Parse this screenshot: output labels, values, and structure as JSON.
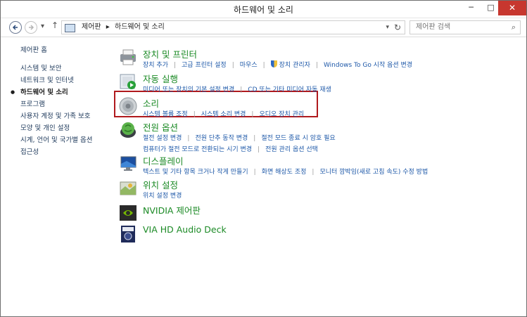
{
  "window": {
    "title": "하드웨어 및 소리"
  },
  "window_controls": {
    "minimize": "─",
    "maximize": "□",
    "close": "✕"
  },
  "nav": {
    "back_icon": "back-arrow-icon",
    "forward_icon": "forward-arrow-icon",
    "recent_glyph": "▾",
    "up_glyph": "↑",
    "breadcrumb": [
      "제어판",
      "▸",
      "하드웨어 및 소리"
    ],
    "dropdown_glyph": "▾",
    "refresh_glyph": "↻"
  },
  "search": {
    "placeholder": "제어판 검색",
    "icon_glyph": "⌕"
  },
  "sidebar": {
    "home": "제어판 홈",
    "items": [
      "시스템 및 보안",
      "네트워크 및 인터넷",
      "하드웨어 및 소리",
      "프로그램",
      "사용자 계정 및 가족 보호",
      "모양 및 개인 설정",
      "시계, 언어 및 국가별 옵션",
      "접근성"
    ],
    "current_index": 2
  },
  "categories": [
    {
      "title": "장치 및 프린터",
      "links": [
        "장치 추가",
        "고급 프린터 설정",
        "마우스",
        "장치 관리자",
        "Windows To Go 시작 옵션 변경"
      ],
      "icon": "printer-icon"
    },
    {
      "title": "자동 실행",
      "links": [
        "미디어 또는 장치의 기본 설정 변경",
        "CD 또는 기타 미디어 자동 재생"
      ],
      "icon": "autoplay-icon"
    },
    {
      "title": "소리",
      "links": [
        "시스템 볼륨 조정",
        "시스템 소리 변경",
        "오디오 장치 관리"
      ],
      "icon": "speaker-icon"
    },
    {
      "title": "전원 옵션",
      "links": [
        "절전 설정 변경",
        "전원 단추 동작 변경",
        "절전 모드 종료 시 암호 필요",
        "컴퓨터가 절전 모드로 전환되는 시기 변경",
        "전원 관리 옵션 선택"
      ],
      "icon": "power-icon"
    },
    {
      "title": "디스플레이",
      "links": [
        "텍스트 및 기타 항목 크거나 작게 만들기",
        "화면 해상도 조정",
        "모니터 깜박임(새로 고침 속도) 수정 방법"
      ],
      "icon": "display-icon"
    },
    {
      "title": "위치 설정",
      "links": [
        "위치 설정 변경"
      ],
      "icon": "location-icon"
    },
    {
      "title": "NVIDIA 제어판",
      "links": [],
      "icon": "nvidia-icon"
    },
    {
      "title": "VIA HD Audio Deck",
      "links": [],
      "icon": "via-audio-icon"
    }
  ],
  "highlight": {
    "color": "#b0191d",
    "target": "소리"
  },
  "colors": {
    "title_green": "#1b8a25",
    "link_blue": "#1e58a8",
    "close_red": "#c7372f"
  }
}
